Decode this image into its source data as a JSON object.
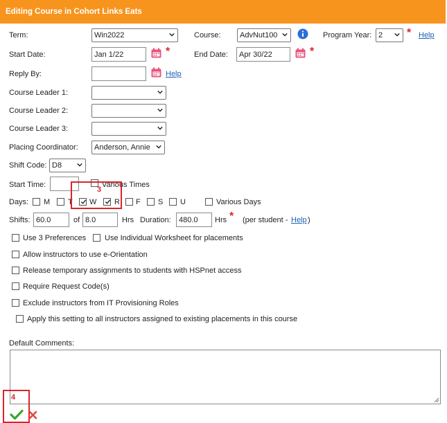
{
  "title": "Editing Course in Cohort Links Eats",
  "fields": {
    "term_label": "Term:",
    "term_value": "Win2022",
    "course_label": "Course:",
    "course_value": "AdvNut100",
    "program_year_label": "Program Year:",
    "program_year_value": "2",
    "help": "Help",
    "start_date_label": "Start Date:",
    "start_date_value": "Jan 1/22",
    "end_date_label": "End Date:",
    "end_date_value": "Apr 30/22",
    "reply_by_label": "Reply By:",
    "reply_by_value": "",
    "leader1_label": "Course Leader 1:",
    "leader2_label": "Course Leader 2:",
    "leader3_label": "Course Leader 3:",
    "placing_label": "Placing Coordinator:",
    "placing_value": "Anderson, Annie",
    "shift_code_label": "Shift Code:",
    "shift_code_value": "D8",
    "start_time_label": "Start Time:",
    "start_time_value": "",
    "various_times": "Various Times",
    "days_label": "Days:",
    "days": [
      {
        "label": "M",
        "checked": false
      },
      {
        "label": "T",
        "checked": false
      },
      {
        "label": "W",
        "checked": true
      },
      {
        "label": "R",
        "checked": true
      },
      {
        "label": "F",
        "checked": false
      },
      {
        "label": "S",
        "checked": false
      },
      {
        "label": "U",
        "checked": false
      }
    ],
    "various_days": "Various Days",
    "shifts_label": "Shifts:",
    "shifts_value": "60.0",
    "of_label": "of",
    "hours_value": "8.0",
    "hrs_label": "Hrs",
    "duration_label": "Duration:",
    "duration_value": "480.0",
    "hrs2_label": "Hrs",
    "per_student_prefix": "(per student - ",
    "per_student_suffix": ")"
  },
  "options": {
    "use3": "Use 3 Preferences",
    "individual_ws": "Use Individual Worksheet for placements",
    "eorientation": "Allow instructors to use e-Orientation",
    "release_temp": "Release temporary assignments to students with HSPnet access",
    "request_code": "Require Request Code(s)",
    "exclude_it": "Exclude instructors from IT Provisioning Roles",
    "apply_setting": "Apply this setting to all instructors assigned to existing placements in this course"
  },
  "comments": {
    "label": "Default Comments:",
    "value": ""
  },
  "annotations": {
    "box3": "3",
    "box4": "4"
  },
  "colors": {
    "titlebar": "#f7941d",
    "required": "#d9252a",
    "link": "#1a5fb4",
    "calendar": "#e8557f",
    "info": "#2a6fd6",
    "save": "#3aa535",
    "cancel": "#e2463f"
  }
}
